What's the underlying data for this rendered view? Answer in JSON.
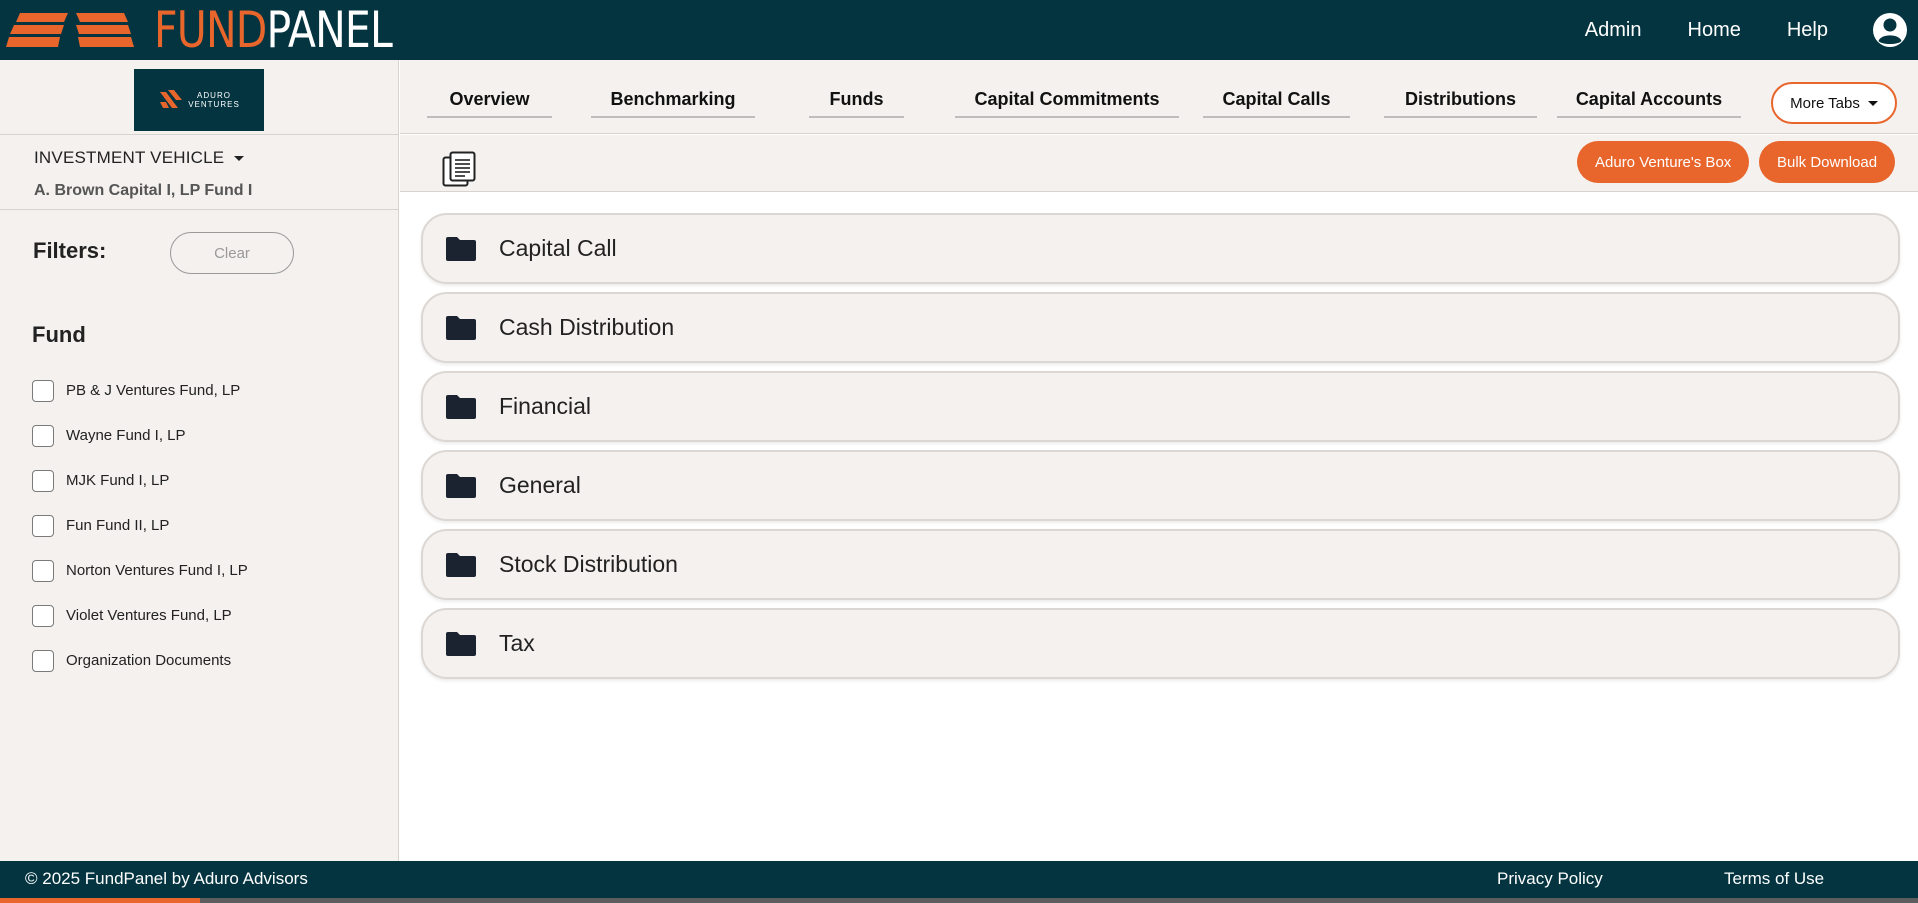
{
  "header": {
    "brand_fund": "FUND",
    "brand_panel": "PANEL",
    "nav": [
      {
        "label": "Admin"
      },
      {
        "label": "Home"
      },
      {
        "label": "Help"
      }
    ]
  },
  "sidebar": {
    "logo_line1": "ADURO",
    "logo_line2": "VENTURES",
    "investment_vehicle_label": "INVESTMENT VEHICLE",
    "investment_vehicle_value": "A. Brown Capital I, LP Fund I",
    "filters_label": "Filters:",
    "clear_label": "Clear",
    "fund_heading": "Fund",
    "funds": [
      {
        "label": "PB & J Ventures Fund, LP"
      },
      {
        "label": "Wayne Fund I, LP"
      },
      {
        "label": "MJK Fund I, LP"
      },
      {
        "label": "Fun Fund II, LP"
      },
      {
        "label": "Norton Ventures Fund I, LP"
      },
      {
        "label": "Violet Ventures Fund, LP"
      },
      {
        "label": "Organization Documents"
      }
    ]
  },
  "tabs": [
    {
      "label": "Overview"
    },
    {
      "label": "Benchmarking"
    },
    {
      "label": "Funds"
    },
    {
      "label": "Capital Commitments"
    },
    {
      "label": "Capital Calls"
    },
    {
      "label": "Distributions"
    },
    {
      "label": "Capital Accounts"
    }
  ],
  "more_tabs_label": "More Tabs",
  "actions": {
    "box_label": "Aduro Venture's Box",
    "bulk_download_label": "Bulk Download"
  },
  "folders": [
    {
      "label": "Capital Call"
    },
    {
      "label": "Cash Distribution"
    },
    {
      "label": "Financial"
    },
    {
      "label": "General"
    },
    {
      "label": "Stock Distribution"
    },
    {
      "label": "Tax"
    }
  ],
  "footer": {
    "copyright": "© 2025 FundPanel by Aduro Advisors",
    "privacy_label": "Privacy Policy",
    "terms_label": "Terms of Use"
  },
  "colors": {
    "navy": "#033440",
    "accent_orange": "#e8652b",
    "panel_beige": "#f4f1ee"
  },
  "icons": {
    "brand_mark": "fundpanel-stripes-logo",
    "user": "user-circle-icon",
    "document": "document-icon",
    "folder": "folder-icon"
  }
}
